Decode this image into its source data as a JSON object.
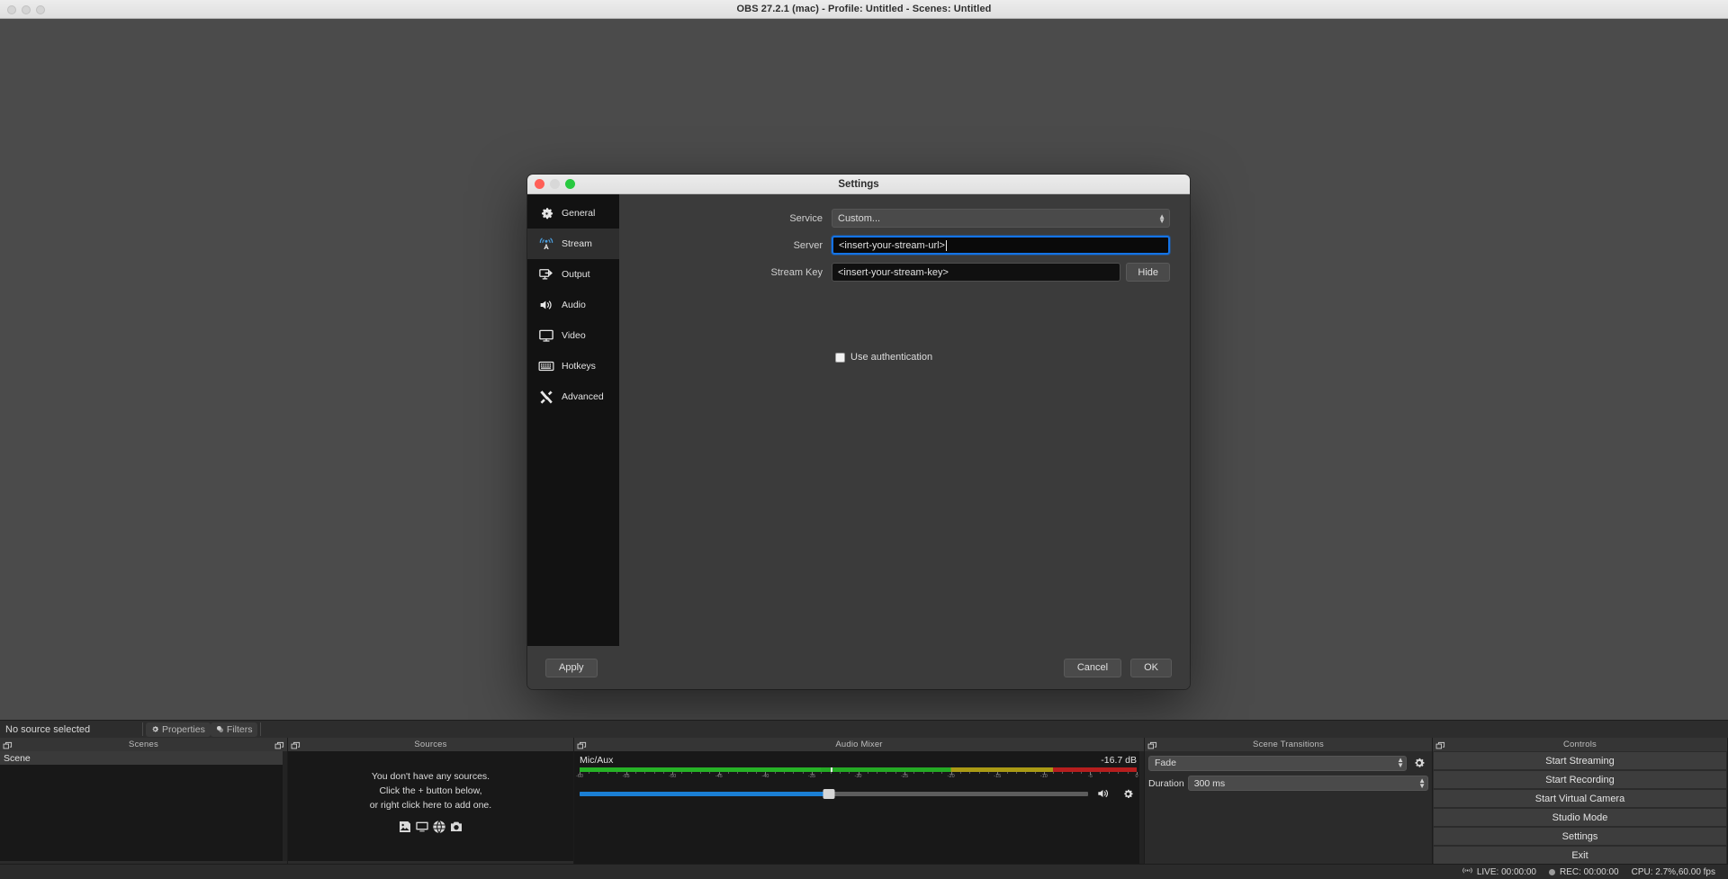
{
  "window": {
    "title": "OBS 27.2.1 (mac) - Profile: Untitled - Scenes: Untitled"
  },
  "settings_dialog": {
    "title": "Settings",
    "nav": [
      {
        "label": "General",
        "icon": "gear-icon",
        "active": false
      },
      {
        "label": "Stream",
        "icon": "broadcast-icon",
        "active": true
      },
      {
        "label": "Output",
        "icon": "output-monitor-icon",
        "active": false
      },
      {
        "label": "Audio",
        "icon": "speaker-icon",
        "active": false
      },
      {
        "label": "Video",
        "icon": "monitor-icon",
        "active": false
      },
      {
        "label": "Hotkeys",
        "icon": "keyboard-icon",
        "active": false
      },
      {
        "label": "Advanced",
        "icon": "tools-icon",
        "active": false
      }
    ],
    "form": {
      "service_label": "Service",
      "service_value": "Custom...",
      "server_label": "Server",
      "server_value": "<insert-your-stream-url>",
      "stream_key_label": "Stream Key",
      "stream_key_value": "<insert-your-stream-key>",
      "hide_button": "Hide",
      "use_auth_label": "Use authentication",
      "use_auth_checked": false
    },
    "footer": {
      "apply": "Apply",
      "cancel": "Cancel",
      "ok": "OK"
    },
    "accent_color": "#1473e6"
  },
  "source_toolbar": {
    "status_text": "No source selected",
    "properties_label": "Properties",
    "filters_label": "Filters"
  },
  "docks": {
    "scenes": {
      "title": "Scenes",
      "items": [
        {
          "label": "Scene",
          "selected": true
        }
      ]
    },
    "sources": {
      "title": "Sources",
      "empty_lines": [
        "You don't have any sources.",
        "Click the + button below,",
        "or right click here to add one."
      ]
    },
    "audio_mixer": {
      "title": "Audio Mixer",
      "tracks": [
        {
          "name": "Mic/Aux",
          "db_value": "-16.7 dB",
          "level_db": -34,
          "peak_db": -33,
          "volume_percent": 49
        }
      ],
      "meter_min_db": -60,
      "meter_max_db": 0,
      "tick_labels": [
        "-60",
        "-55",
        "-50",
        "-45",
        "-40",
        "-35",
        "-30",
        "-25",
        "-20",
        "-15",
        "-10",
        "-5",
        "0"
      ],
      "green_end_db": -20,
      "yellow_end_db": -9,
      "colors": {
        "green": "#26b226",
        "yellow": "#b2a216",
        "red": "#c01f1f",
        "slider": "#1b7fd4"
      }
    },
    "scene_transitions": {
      "title": "Scene Transitions",
      "transition_value": "Fade",
      "duration_label": "Duration",
      "duration_value": "300 ms"
    },
    "controls": {
      "title": "Controls",
      "buttons": [
        "Start Streaming",
        "Start Recording",
        "Start Virtual Camera",
        "Studio Mode",
        "Settings",
        "Exit"
      ]
    }
  },
  "statusbar": {
    "live_label": "LIVE: 00:00:00",
    "rec_label": "REC: 00:00:00",
    "cpu_label": "CPU: 2.7%,60.00 fps"
  }
}
